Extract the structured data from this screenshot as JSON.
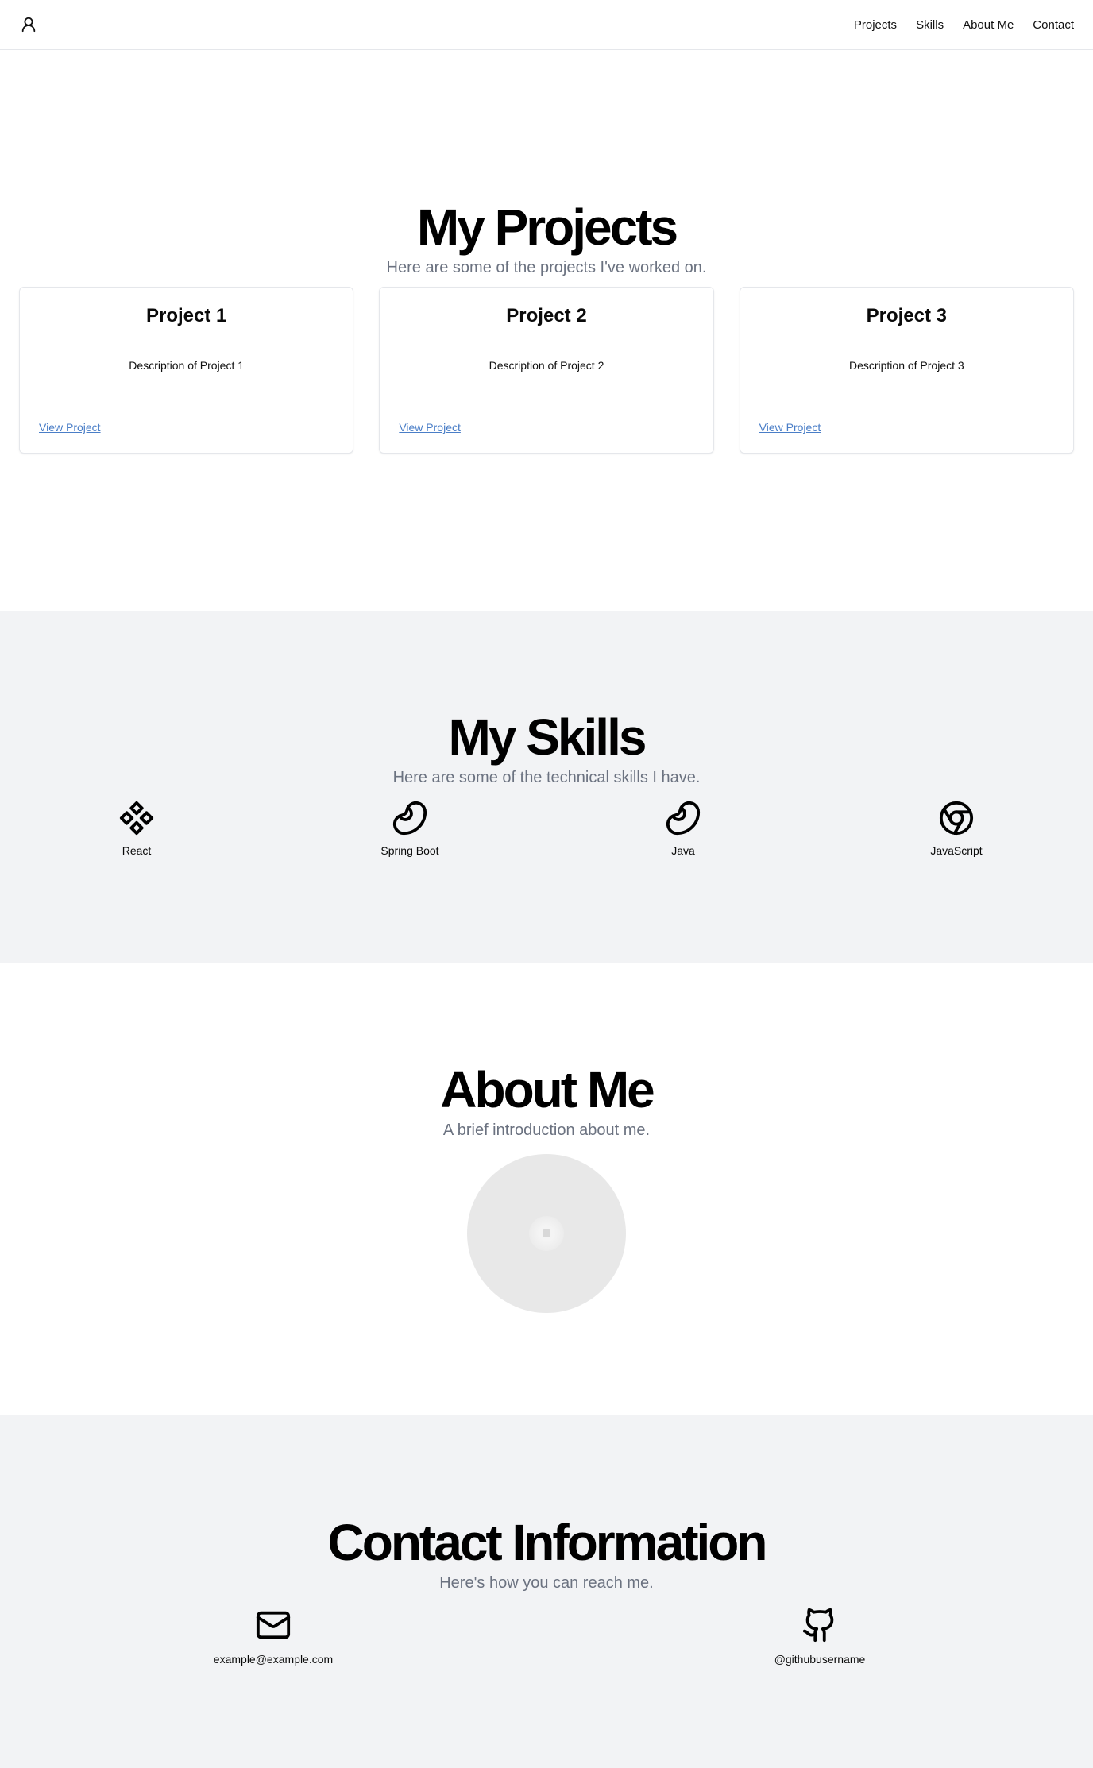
{
  "nav": {
    "items": [
      "Projects",
      "Skills",
      "About Me",
      "Contact"
    ],
    "logo_icon": "user-icon"
  },
  "projects": {
    "title": "My Projects",
    "subtitle": "Here are some of the projects I've worked on.",
    "cards": [
      {
        "title": "Project 1",
        "description": "Description of Project 1",
        "link": "View Project"
      },
      {
        "title": "Project 2",
        "description": "Description of Project 2",
        "link": "View Project"
      },
      {
        "title": "Project 3",
        "description": "Description of Project 3",
        "link": "View Project"
      }
    ]
  },
  "skills": {
    "title": "My Skills",
    "subtitle": "Here are some of the technical skills I have.",
    "items": [
      {
        "label": "React",
        "icon": "component-icon"
      },
      {
        "label": "Spring Boot",
        "icon": "bean-icon"
      },
      {
        "label": "Java",
        "icon": "bean-icon"
      },
      {
        "label": "JavaScript",
        "icon": "chrome-icon"
      }
    ]
  },
  "about": {
    "title": "About Me",
    "subtitle": "A brief introduction about me."
  },
  "contact": {
    "title": "Contact Information",
    "subtitle": "Here's how you can reach me.",
    "email": "example@example.com",
    "github": "@githubusername"
  },
  "colors": {
    "link": "#4a7ec7",
    "muted": "#6b7280",
    "section_alt_bg": "#f2f3f5"
  }
}
